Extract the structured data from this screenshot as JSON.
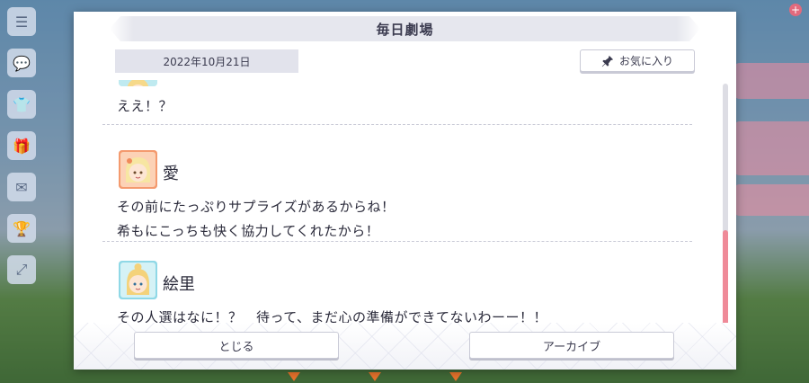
{
  "dialog": {
    "title": "毎日劇場",
    "date": "2022年10月21日",
    "favorite_label": "お気に入り",
    "close_label": "とじる",
    "archive_label": "アーカイブ"
  },
  "entries": [
    {
      "speaker": "",
      "lines": [
        "ええ！？"
      ]
    },
    {
      "speaker": "愛",
      "lines": [
        "その前にたっぷりサプライズがあるからね！",
        "希もにこっちも快く協力してくれたから！"
      ]
    },
    {
      "speaker": "絵里",
      "lines": [
        "その人選はなに！？　待って、まだ心の準備ができてないわーー！！"
      ]
    }
  ],
  "scroll": {
    "position": 1.0
  },
  "colors": {
    "accent_pink": "#ef8a98",
    "panel": "#e6e7ee",
    "text": "#2b2b3b"
  }
}
